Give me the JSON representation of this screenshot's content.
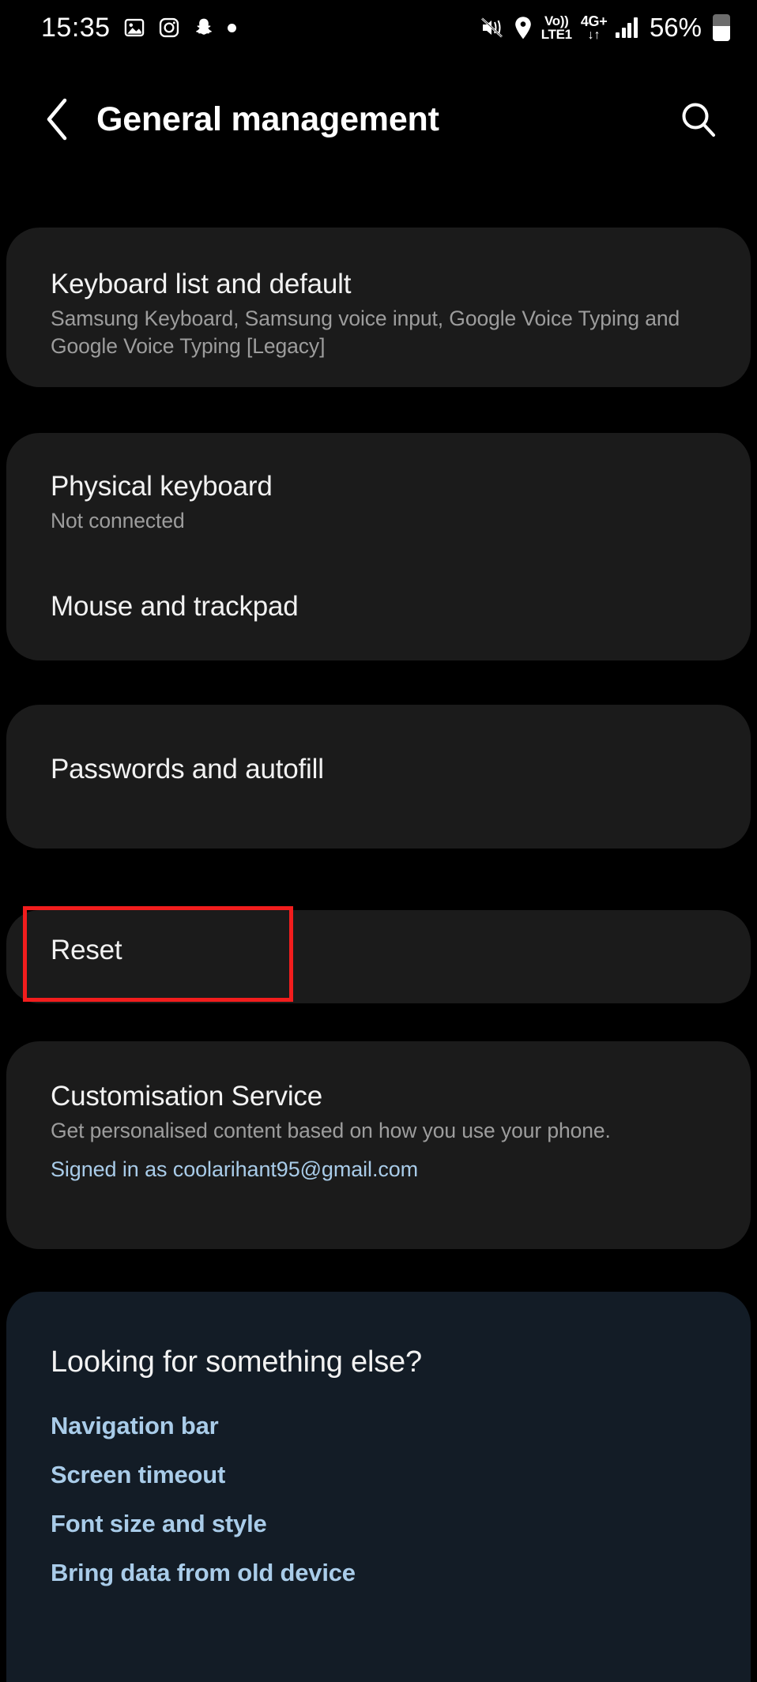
{
  "status_bar": {
    "time": "15:35",
    "left_icons": [
      "gallery-icon",
      "instagram-icon",
      "snapchat-icon",
      "dot-indicator"
    ],
    "right_icons": [
      "vibrate-off-icon",
      "location-icon",
      "volte-icon",
      "mobile-data-icon",
      "signal-bars-icon",
      "battery-icon"
    ],
    "volte_line1": "Vo))",
    "volte_line2": "LTE1",
    "network_type": "4G+",
    "data_arrows": "↓↑",
    "battery_percent": "56%",
    "battery_level": 56,
    "signal_bars_filled": 3,
    "signal_bars_total": 4
  },
  "header": {
    "back_label": "back-chevron",
    "title": "General management",
    "search_label": "search-icon"
  },
  "cards": {
    "keyboard": {
      "title": "Keyboard list and default",
      "subtitle": "Samsung Keyboard, Samsung voice input, Google Voice Typing and Google Voice Typing [Legacy]"
    },
    "physical_keyboard": {
      "title": "Physical keyboard",
      "subtitle": "Not connected"
    },
    "mouse_trackpad": {
      "title": "Mouse and trackpad"
    },
    "passwords": {
      "title": "Passwords and autofill"
    },
    "reset": {
      "title": "Reset"
    },
    "customisation": {
      "title": "Customisation Service",
      "subtitle": "Get personalised content based on how you use your phone.",
      "account_link": "Signed in as coolarihant95@gmail.com"
    },
    "more": {
      "title": "Looking for something else?",
      "links": [
        "Navigation bar",
        "Screen timeout",
        "Font size and style",
        "Bring data from old device"
      ]
    }
  },
  "annotation": {
    "target": "Reset",
    "color": "#f21d1d"
  },
  "colors": {
    "background": "#000000",
    "card": "#1b1b1b",
    "card_tinted": "#131c26",
    "title_text": "#f2f2f2",
    "secondary_text": "#9d9d9d",
    "link_text": "#a9cce9",
    "divider": "#454545",
    "annotation": "#f21d1d"
  }
}
